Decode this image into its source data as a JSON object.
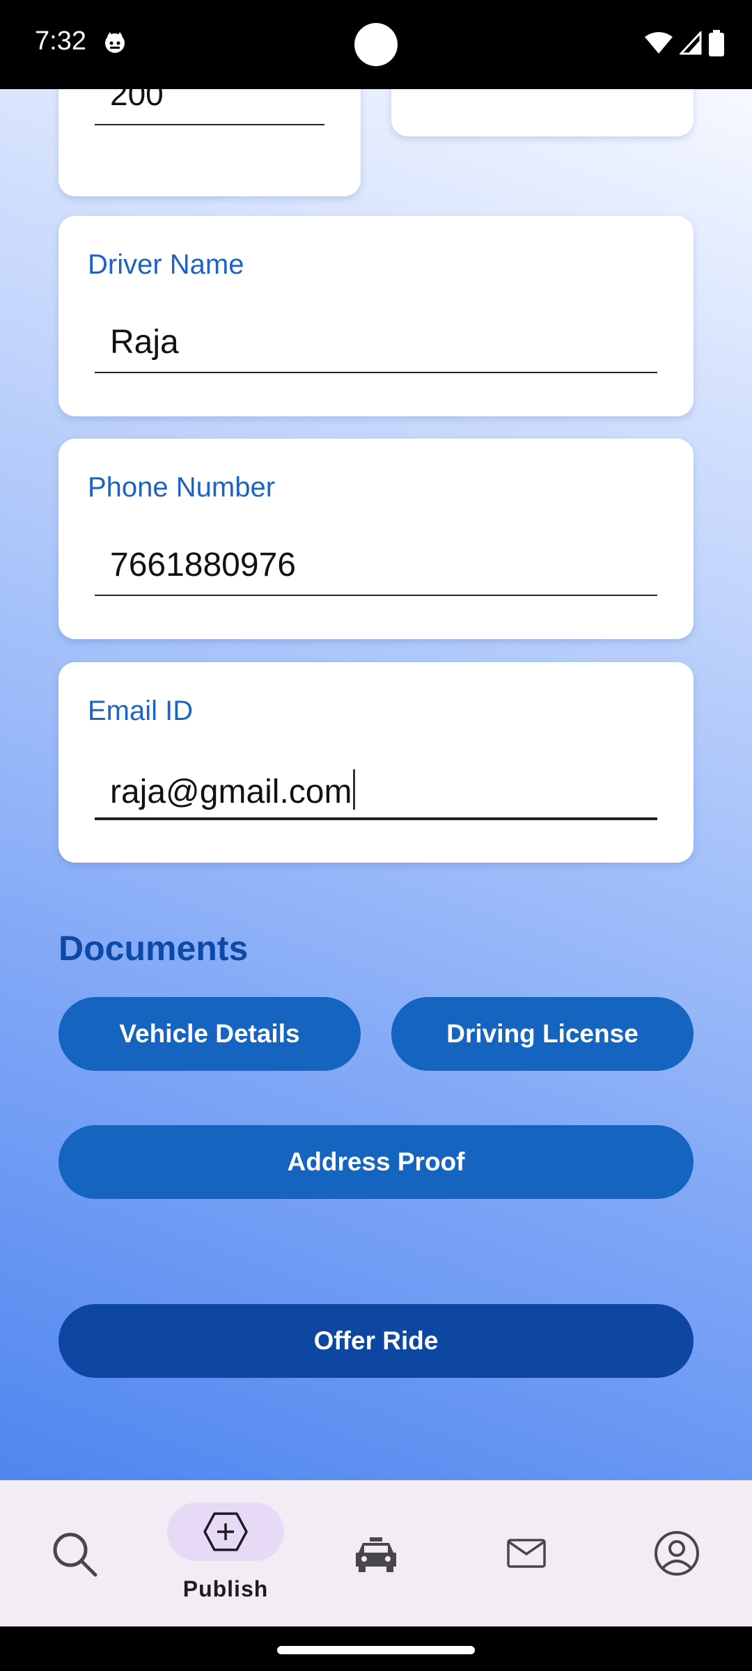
{
  "status_bar": {
    "time": "7:32"
  },
  "form": {
    "partial_top_value": "200",
    "driver_name": {
      "label": "Driver Name",
      "value": "Raja"
    },
    "phone_number": {
      "label": "Phone Number",
      "value": "7661880976"
    },
    "email": {
      "label": "Email ID",
      "value": "raja@gmail.com"
    }
  },
  "documents": {
    "title": "Documents",
    "vehicle_details": "Vehicle Details",
    "driving_license": "Driving License",
    "address_proof": "Address Proof"
  },
  "offer_ride": "Offer Ride",
  "bottom_nav": {
    "items": [
      {
        "icon": "search-icon",
        "label": ""
      },
      {
        "icon": "add-circle-icon",
        "label": "Publish",
        "active": true
      },
      {
        "icon": "car-icon",
        "label": ""
      },
      {
        "icon": "mail-icon",
        "label": ""
      },
      {
        "icon": "account-icon",
        "label": ""
      }
    ]
  },
  "colors": {
    "accent": "#1565c0",
    "accent_dark": "#0d47a1",
    "label_blue": "#1c63c2",
    "nav_bg": "#f2ecf5",
    "nav_active_pill": "#e7daf7"
  }
}
